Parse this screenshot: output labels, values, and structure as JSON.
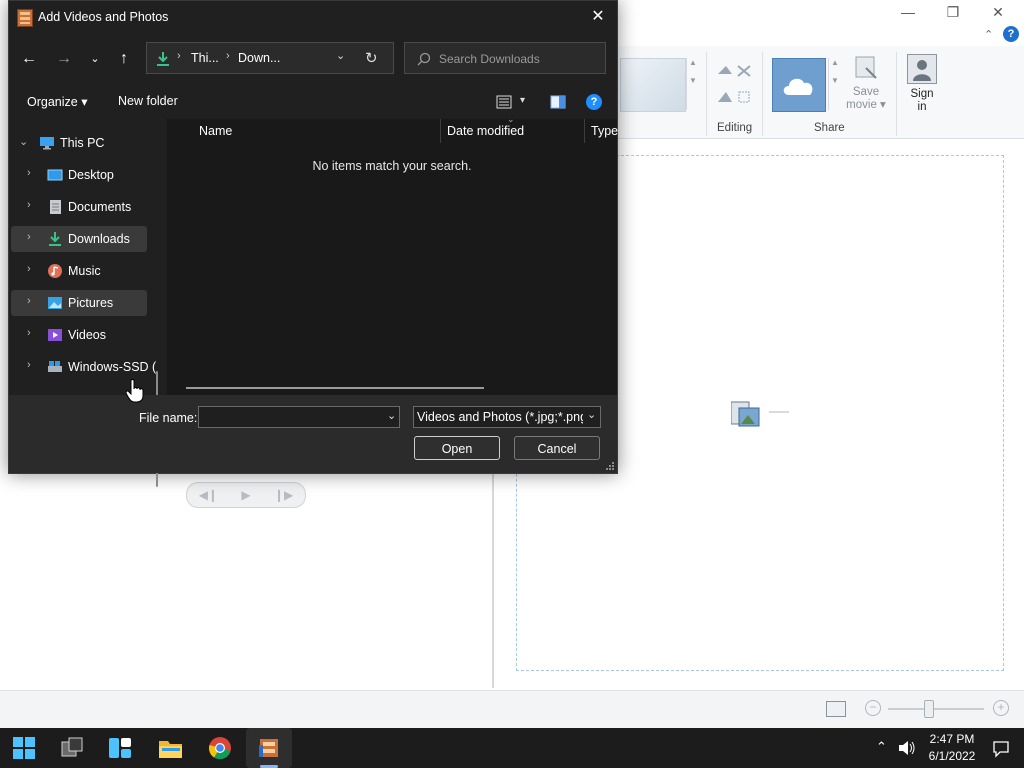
{
  "dialog": {
    "title": "Add Videos and Photos",
    "address": {
      "crumb1": "Thi...",
      "crumb2": "Down..."
    },
    "search_placeholder": "Search Downloads",
    "commands": {
      "organize": "Organize",
      "new_folder": "New folder"
    },
    "nav": {
      "root": "This PC",
      "items": [
        {
          "label": "Desktop",
          "selected": false
        },
        {
          "label": "Documents",
          "selected": false
        },
        {
          "label": "Downloads",
          "selected": true
        },
        {
          "label": "Music",
          "selected": false
        },
        {
          "label": "Pictures",
          "selected": true
        },
        {
          "label": "Videos",
          "selected": false
        },
        {
          "label": "Windows-SSD (",
          "selected": false
        }
      ]
    },
    "columns": {
      "name": "Name",
      "date_modified": "Date modified",
      "type": "Type"
    },
    "empty_message": "No items match your search.",
    "file_name_label": "File name:",
    "file_name_value": "",
    "filter": "Videos and Photos (*.jpg;*.png;",
    "open_label": "Open",
    "cancel_label": "Cancel"
  },
  "ribbon": {
    "editing_label": "Editing",
    "share_label": "Share",
    "save_movie": {
      "line1": "Save",
      "line2": "movie"
    },
    "sign_in": {
      "line1": "Sign",
      "line2": "in"
    }
  },
  "taskbar": {
    "time": "2:47 PM",
    "date": "6/1/2022"
  },
  "colors": {
    "dialog_bg": "#202020",
    "selection": "#3a3a3a",
    "accent": "#8ab4f8",
    "help": "#1f8fff"
  }
}
